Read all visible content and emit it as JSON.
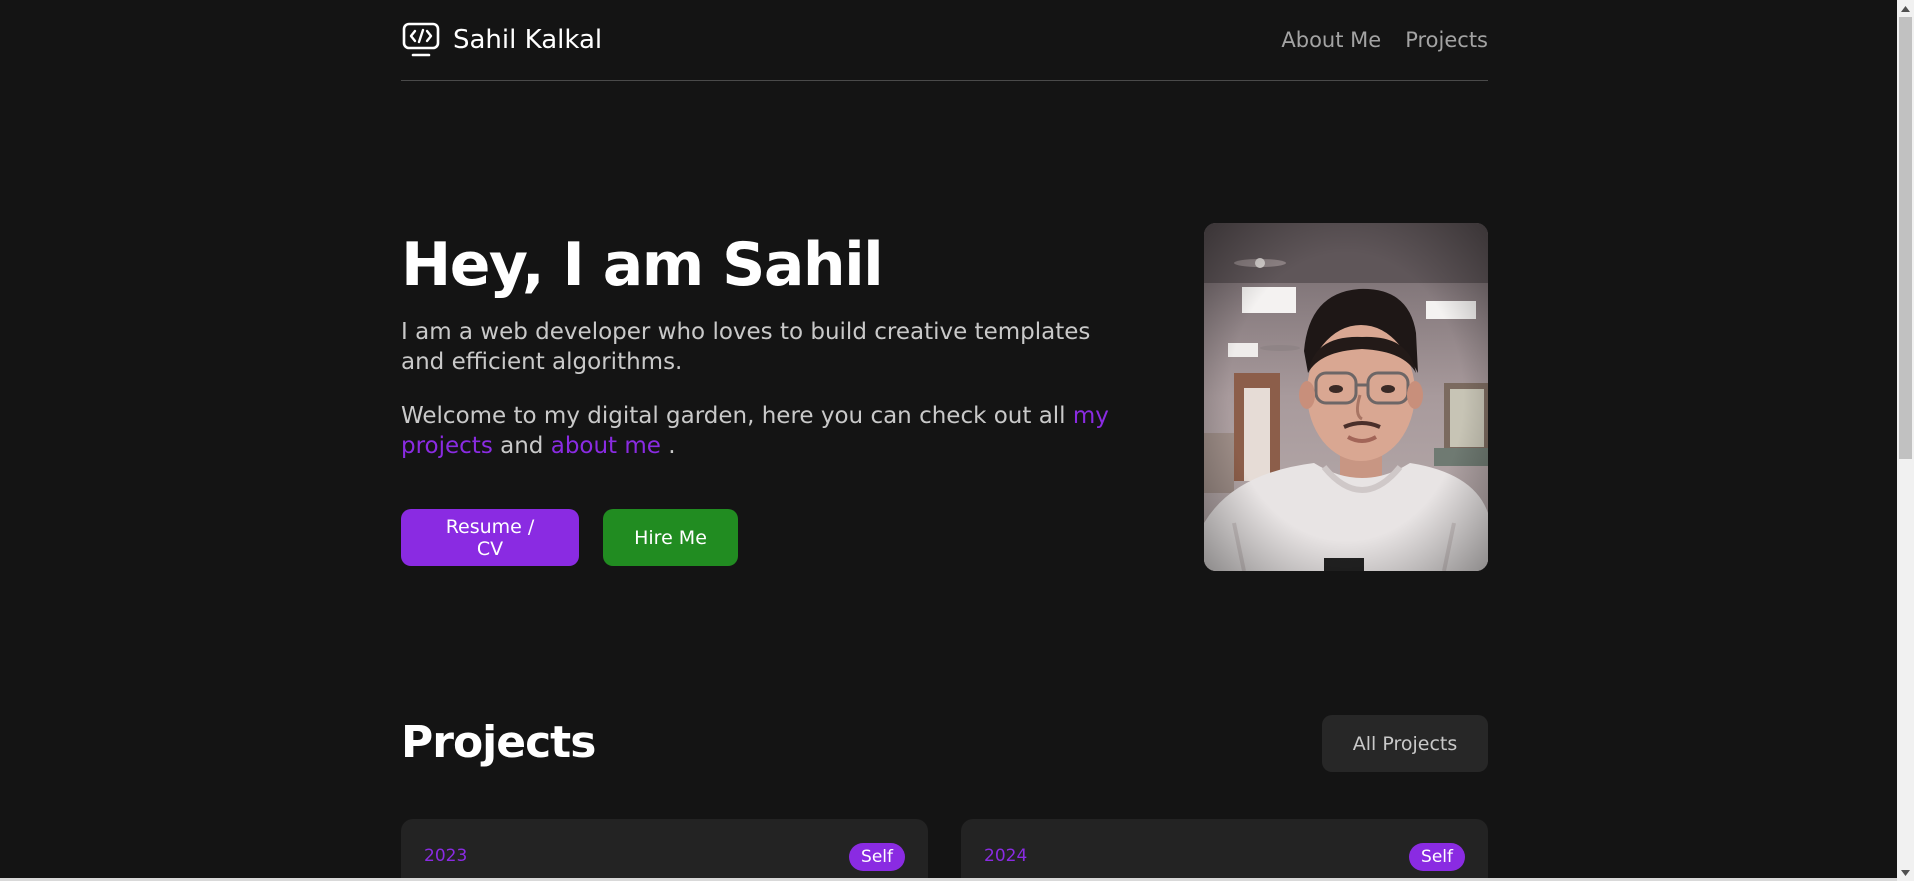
{
  "header": {
    "brand_name": "Sahil Kalkal",
    "brand_icon": "code-monitor-icon",
    "nav": [
      {
        "label": "About Me"
      },
      {
        "label": "Projects"
      }
    ]
  },
  "hero": {
    "title": "Hey, I am Sahil",
    "intro": "I am a web developer who loves to build creative templates and efficient algorithms.",
    "welcome_prefix": "Welcome to my digital garden, here you can check out all",
    "link_projects": "my projects",
    "welcome_and": "and",
    "link_about": "about me",
    "welcome_suffix": ".",
    "resume_label": "Resume / CV",
    "hire_label": "Hire Me",
    "avatar_icon": "profile-photo"
  },
  "projects": {
    "title": "Projects",
    "all_label": "All Projects",
    "cards": [
      {
        "year": "2023",
        "badge": "Self"
      },
      {
        "year": "2024",
        "badge": "Self"
      }
    ]
  },
  "colors": {
    "background": "#141414",
    "accent": "#8a2be2",
    "hire": "#218c21",
    "muted_text": "#a3a3a3",
    "card": "#232323"
  }
}
